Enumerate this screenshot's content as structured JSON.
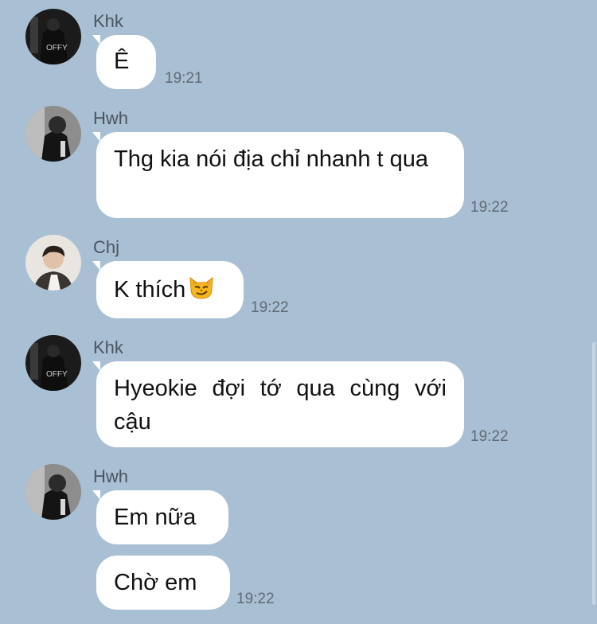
{
  "messages": [
    {
      "sender": "Khk",
      "text": "Ê",
      "time": "19:21"
    },
    {
      "sender": "Hwh",
      "text": "Thg kia nói địa chỉ nhanh t qua",
      "time": "19:22"
    },
    {
      "sender": "Chj",
      "text": "K thích",
      "emoji": "smirking-cat",
      "time": "19:22"
    },
    {
      "sender": "Khk",
      "text": "Hyeokie đợi tớ qua cùng với cậu",
      "time": "19:22"
    },
    {
      "sender": "Hwh",
      "text": "Em nữa",
      "time": ""
    },
    {
      "sender": "Hwh",
      "text": "Chờ em",
      "time": "19:22"
    }
  ],
  "colors": {
    "background": "#a9bfd3",
    "bubble": "#ffffff",
    "name": "#4a5560",
    "time": "#5f6b76"
  }
}
